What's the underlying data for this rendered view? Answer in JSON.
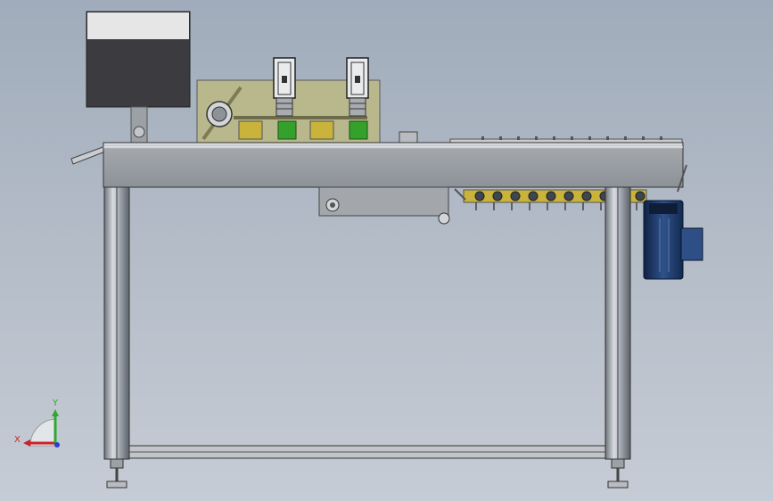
{
  "viewport": {
    "background_top": "#a0acbb",
    "background_bottom": "#c6ccd5"
  },
  "model": {
    "frame_color": "#8a9099",
    "table_top_color": "#9fa3a8",
    "panel_color": "#b9b98a",
    "screen_top_color": "#e6e6e6",
    "screen_bottom_color": "#3b3b40",
    "motor_color": "#1f3c6b",
    "accent_green": "#35a12d",
    "accent_yellow": "#c9b33a"
  },
  "triad": {
    "x_label": "X",
    "y_label": "Y",
    "x_color": "#d0202a",
    "y_color": "#2fa82f",
    "z_color": "#2a3fd0",
    "x_icon": "x-axis-arrow-icon",
    "y_icon": "y-axis-arrow-icon",
    "z_icon": "z-axis-dot-icon"
  }
}
